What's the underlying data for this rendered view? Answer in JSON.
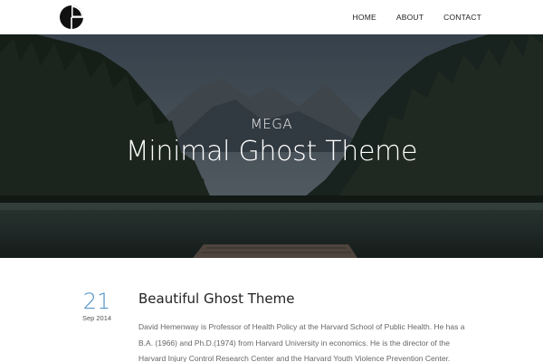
{
  "header": {
    "logo_icon": "pie-chart-logo-icon",
    "nav": [
      {
        "label": "HOME"
      },
      {
        "label": "ABOUT"
      },
      {
        "label": "CONTACT"
      }
    ]
  },
  "hero": {
    "kicker": "MEGA",
    "title": "Minimal Ghost Theme"
  },
  "post": {
    "day": "21",
    "month_year": "Sep 2014",
    "title": "Beautiful Ghost Theme",
    "excerpt": "David Hemenway is Professor of Health Policy at the Harvard School of Public Health. He has a B.A. (1966) and Ph.D.(1974) from Harvard University in economics. He is the director of the Harvard Injury Control Research Center and the Harvard Youth Violence Prevention Center."
  },
  "colors": {
    "accent": "#4a90c8",
    "text": "#222222"
  }
}
